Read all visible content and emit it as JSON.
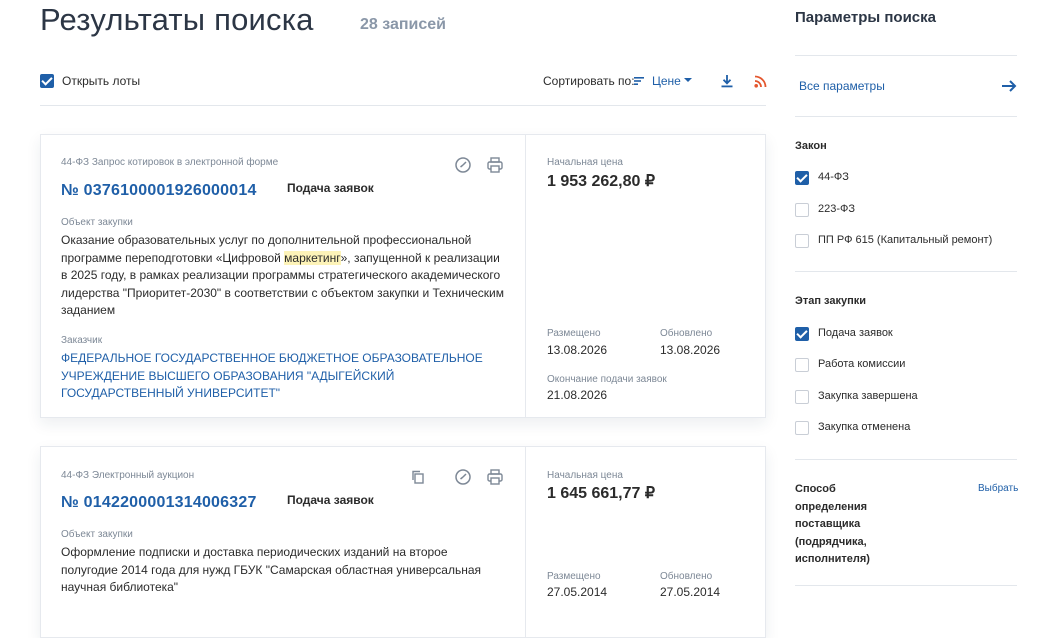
{
  "header": {
    "title": "Результаты поиска",
    "count": "28 записей"
  },
  "toolbar": {
    "open_lots_label": "Открыть лоты",
    "open_lots_checked": true,
    "sort_label": "Сортировать по:",
    "sort_value": "Цене",
    "sort_icon": "sort-icon",
    "download_icon": "download-icon",
    "rss_icon": "rss-icon"
  },
  "results": [
    {
      "procedure_type": "44-ФЗ Запрос котировок в электронной форме",
      "number": "№ 0376100001926000014",
      "status": "Подача заявок",
      "object_label": "Объект закупки",
      "object_parts": [
        "Оказание образовательных услуг по дополнительной профессиональной программе переподготовки «Цифровой ",
        "маркетинг",
        "», запущенной к реализации в 2025 году, в рамках реализации программы стратегического академического лидерства \"Приоритет-2030\" в соответствии с объектом закупки и Техническим заданием"
      ],
      "customer_label": "Заказчик",
      "customer": "ФЕДЕРАЛЬНОЕ ГОСУДАРСТВЕННОЕ БЮДЖЕТНОЕ ОБРАЗОВАТЕЛЬНОЕ УЧРЕЖДЕНИЕ ВЫСШЕГО ОБРАЗОВАНИЯ \"АДЫГЕЙСКИЙ ГОСУДАРСТВЕННЫЙ УНИВЕРСИТЕТ\"",
      "price_label": "Начальная цена",
      "price": "1 953 262,80 ₽",
      "posted_label": "Размещено",
      "posted": "13.08.2026",
      "updated_label": "Обновлено",
      "updated": "13.08.2026",
      "deadline_label": "Окончание подачи заявок",
      "deadline": "21.08.2026"
    },
    {
      "procedure_type": "44-ФЗ Электронный аукцион",
      "number": "№ 0142200001314006327",
      "status": "Подача заявок",
      "object_label": "Объект закупки",
      "object": "Оформление подписки и доставка периодических изданий на второе полугодие 2014 года для нужд ГБУК \"Самарская областная универсальная научная библиотека\"",
      "price_label": "Начальная цена",
      "price": "1 645 661,77 ₽",
      "posted_label": "Размещено",
      "posted": "27.05.2014",
      "updated_label": "Обновлено",
      "updated": "27.05.2014"
    }
  ],
  "sidebar": {
    "title": "Параметры поиска",
    "all_params": "Все параметры",
    "law_title": "Закон",
    "law_items": [
      {
        "label": "44-ФЗ",
        "checked": true
      },
      {
        "label": "223-ФЗ",
        "checked": false
      },
      {
        "label": "ПП РФ 615 (Капитальный ремонт)",
        "checked": false
      }
    ],
    "stage_title": "Этап закупки",
    "stage_items": [
      {
        "label": "Подача заявок",
        "checked": true
      },
      {
        "label": "Работа комиссии",
        "checked": false
      },
      {
        "label": "Закупка завершена",
        "checked": false
      },
      {
        "label": "Закупка отменена",
        "checked": false
      }
    ],
    "method_title": "Способ определения поставщика (подрядчика, исполнителя)",
    "method_choose": "Выбрать"
  },
  "colors": {
    "accent": "#1f5fa8",
    "highlight": "#fdf3b8",
    "title": "#2c3645"
  }
}
